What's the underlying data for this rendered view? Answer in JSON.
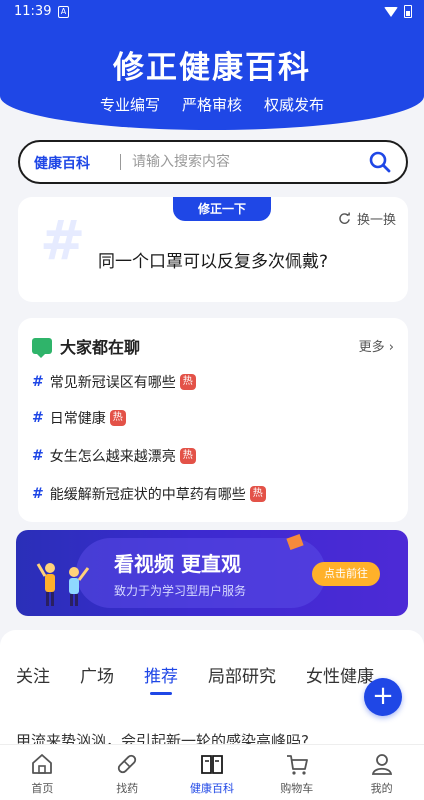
{
  "status": {
    "time": "11:39",
    "notif": "A"
  },
  "hero": {
    "title": "修正健康百科",
    "tags": [
      "专业编写",
      "严格审核",
      "权威发布"
    ]
  },
  "search": {
    "brand": "健康百科",
    "placeholder": "请输入搜索内容"
  },
  "fix_card": {
    "badge": "修正一下",
    "refresh": "换一换",
    "question": "同一个口罩可以反复多次佩戴?"
  },
  "chat": {
    "title": "大家都在聊",
    "more": "更多",
    "hot_label": "热",
    "topics": [
      {
        "text": "常见新冠误区有哪些",
        "hot": true
      },
      {
        "text": "日常健康",
        "hot": true
      },
      {
        "text": "女生怎么越来越漂亮",
        "hot": true
      },
      {
        "text": "能缓解新冠症状的中草药有哪些",
        "hot": true
      }
    ]
  },
  "banner": {
    "title": "看视频 更直观",
    "subtitle": "致力于为学习型用户服务",
    "button": "点击前往"
  },
  "feed": {
    "tabs": [
      "关注",
      "广场",
      "推荐",
      "局部研究",
      "女性健康"
    ],
    "active_tab": "推荐",
    "peek": "甲流来势汹汹，会引起新一轮的感染高峰吗?"
  },
  "nav": {
    "items": [
      "首页",
      "找药",
      "健康百科",
      "购物车",
      "我的"
    ],
    "active": "健康百科"
  },
  "colors": {
    "brand": "#1f47e6",
    "hot": "#e35248",
    "chat_icon": "#2fb46a",
    "banner_btn": "#ffb12a"
  }
}
